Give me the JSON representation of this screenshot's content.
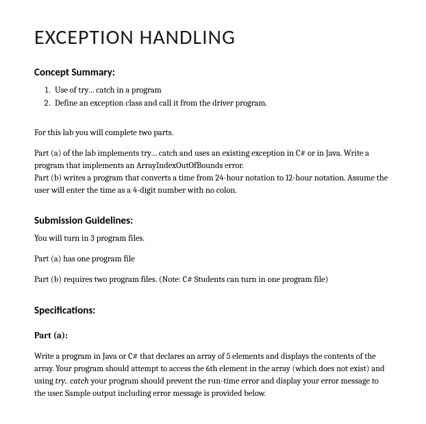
{
  "title": "EXCEPTION HANDLING",
  "conceptSummary": {
    "heading": "Concept Summary:",
    "items": [
      "Use of try… catch in a program",
      "Define an exception class and call it from the driver program."
    ]
  },
  "intro": {
    "p1": "For this lab you will complete two parts.",
    "p2": "Part (a) of the lab implements try… catch and uses an existing exception in C# or in Java. Write a program that implements an ArrayIndexOutOfBounds error.\nPart (b) writes a program that converts a time from 24-hour notation to 12-hour notation. Assume the user will enter the time as a 4-digit number with no colon."
  },
  "submission": {
    "heading": "Submission Guidelines:",
    "p1": "You will turn in 3 program files.",
    "p2": "Part (a) has one program file",
    "p3": "Part (b) requires two program files. (Note: C# Students can turn in one program file)"
  },
  "specs": {
    "heading": "Specifications:",
    "partA": {
      "heading": "Part (a):",
      "body_pre": "Write a program in Java or C# that declares an array of 5 elements and displays the contents of the array. Your program should attempt to access the 6th element in the array (which does not exist) and using  ",
      "body_ital": "try.. catch",
      "body_post": " your program should prevent the run-time error and display your error message to the user. Sample output including error message is provided below."
    }
  }
}
